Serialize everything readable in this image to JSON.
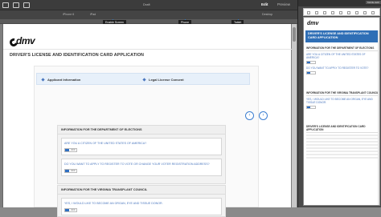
{
  "toolbar": {
    "title": "Draft",
    "edit_label": "Edit",
    "preview_label": "Preview"
  },
  "devices": {
    "phone": "iPhone 6",
    "tablet": "iPad",
    "desktop": "Desktop"
  },
  "chips": {
    "sel": "Enable Screen",
    "phone": "Phone",
    "tablet": "Tablet"
  },
  "form": {
    "logo": "dmv",
    "title": "DRIVER'S LICENSE AND IDENTIFICATION CARD APPLICATION",
    "steps": [
      "Applicant Information",
      "Legal License Consent"
    ],
    "sections": [
      {
        "heading": "INFORMATION FOR THE DEPARTMENT OF ELECTIONS",
        "questions": [
          {
            "text": "ARE YOU A CITIZEN OF THE UNITED STATES OF AMERICA?",
            "toggle": "OFF"
          },
          {
            "text": "DO YOU WANT TO APPLY TO REGISTER TO VOTE OR CHANGE YOUR VOTER REGISTRATION ADDRESS?",
            "toggle": "OFF"
          }
        ]
      },
      {
        "heading": "INFORMATION FOR THE VIRGINIA TRANSPLANT COUNCIL",
        "questions": [
          {
            "text": "YES, I WOULD LIKE TO BECOME AN ORGAN, EYE AND TISSUE DONOR.",
            "toggle": "OFF"
          }
        ]
      }
    ]
  },
  "panel": {
    "tag": "Mobile Edit",
    "title": "DRIVER'S LICENSE AND IDENTIFICATION CARD APPLICATION",
    "blocks": [
      {
        "heading": "INFORMATION FOR THE DEPARTMENT OF ELECTIONS",
        "q1": "ARE YOU A CITIZEN OF THE UNITED STATES OF AMERICA?",
        "q2": "DO YOU WANT TO APPLY TO REGISTER TO VOTE?"
      },
      {
        "heading": "INFORMATION FOR THE VIRGINIA TRANSPLANT COUNCIL",
        "q1": "YES, I WOULD LIKE TO BECOME AN ORGAN, EYE AND TISSUE DONOR.",
        "q2": ""
      },
      {
        "heading": "DRIVER'S LICENSE AND IDENTIFICATION CARD APPLICATION",
        "q1": "",
        "q2": ""
      }
    ]
  },
  "colors": {
    "accent": "#2e6fc2",
    "title_bar": "#2f6fb6"
  }
}
